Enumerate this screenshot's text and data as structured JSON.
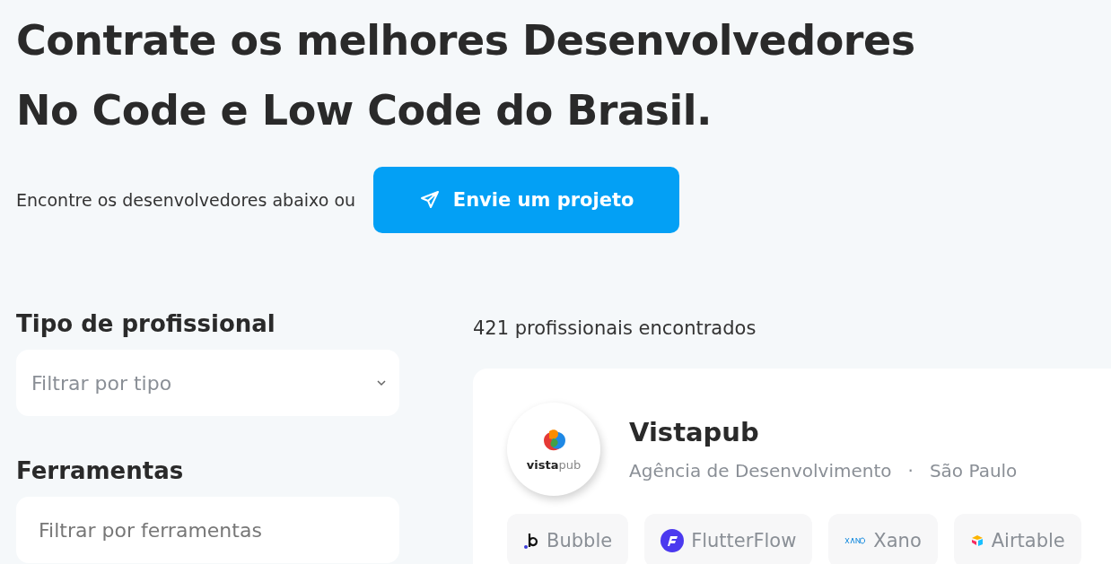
{
  "heading": {
    "lines": [
      "Contrate os melhores Desenvolvedores",
      "No Code e Low Code do Brasil."
    ]
  },
  "intro": {
    "text": "Encontre os desenvolvedores abaixo ou",
    "button": "Envie um projeto"
  },
  "filters": [
    {
      "title": "Tipo de profissional",
      "placeholder": "Filtrar por tipo",
      "kind": "select"
    },
    {
      "title": "Ferramentas",
      "placeholder": "Filtrar por ferramentas",
      "kind": "input"
    }
  ],
  "results": {
    "count": "421 profissionais encontrados"
  },
  "card": {
    "name": "Vistapub",
    "logo": {
      "bold": "vista",
      "light": "pub"
    },
    "type": "Agência de Desenvolvimento",
    "separator": "·",
    "city": "São Paulo",
    "tools": [
      {
        "label": "Bubble",
        "kind": "bubble"
      },
      {
        "label": "FlutterFlow",
        "kind": "flutterflow"
      },
      {
        "label": "Xano",
        "kind": "xano"
      },
      {
        "label": "Airtable",
        "kind": "airtable"
      }
    ]
  }
}
